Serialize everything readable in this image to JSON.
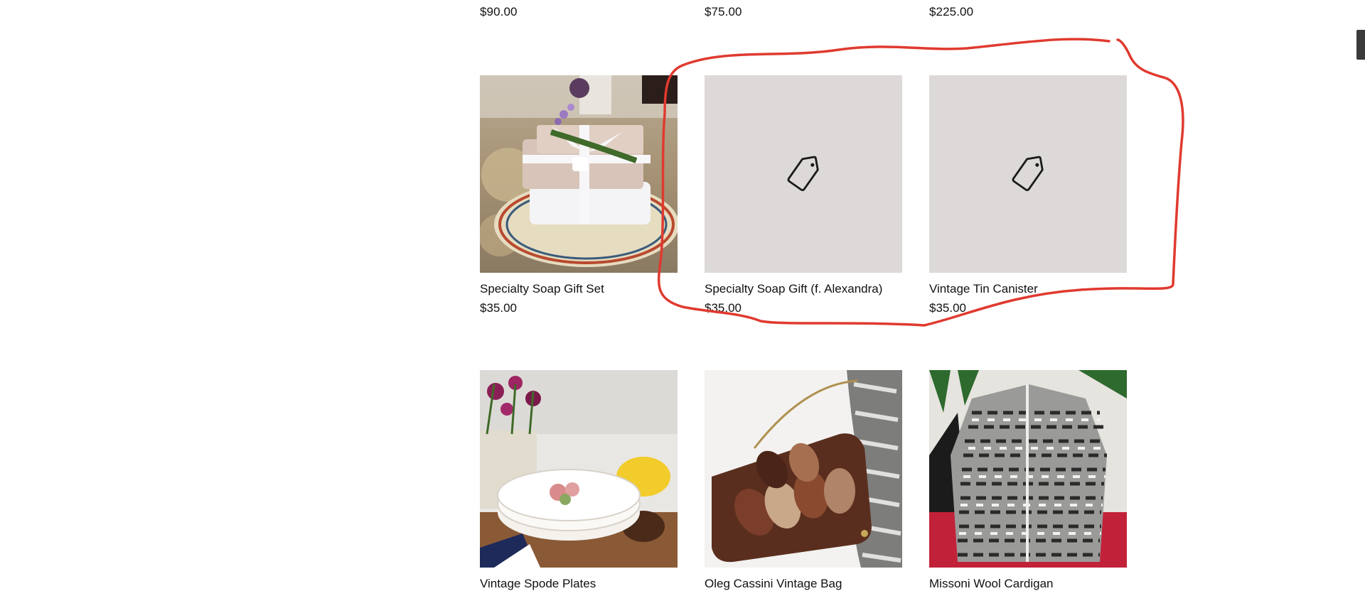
{
  "top_row": {
    "prices": [
      "$90.00",
      "$75.00",
      "$225.00"
    ]
  },
  "row1": {
    "items": [
      {
        "title": "Specialty Soap Gift Set",
        "price": "$35.00",
        "image": "soap-gift-photo"
      },
      {
        "title": "Specialty Soap Gift (f. Alexandra)",
        "price": "$35.00",
        "image": "tag-icon"
      },
      {
        "title": "Vintage Tin Canister",
        "price": "$35.00",
        "image": "tag-icon"
      }
    ]
  },
  "row2": {
    "items": [
      {
        "title": "Vintage Spode Plates",
        "image": "plates-photo"
      },
      {
        "title": "Oleg Cassini Vintage Bag",
        "image": "bag-photo"
      },
      {
        "title": "Missoni Wool Cardigan",
        "image": "cardigan-photo"
      }
    ]
  },
  "colors": {
    "placeholder_bg": "#dcd9d8",
    "annotation_red": "#e03a2f",
    "scrollbar": "#3b3b3b"
  }
}
